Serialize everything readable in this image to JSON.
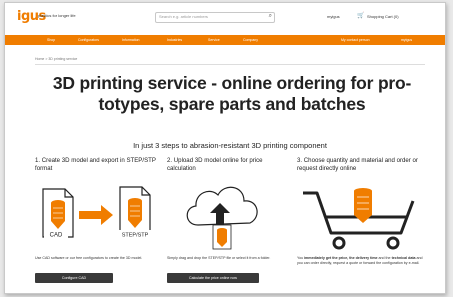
{
  "header": {
    "logo": "igus",
    "tagline": "plastics for longer life",
    "search_placeholder": "Search e.g. article numbers",
    "link_contact": "myigus",
    "cart_label": "Shopping Cart (0)"
  },
  "nav": {
    "items": [
      "Shop",
      "Configurators",
      "Information",
      "Industries",
      "Service",
      "Company"
    ],
    "right": [
      "My contact person",
      "myigus"
    ]
  },
  "breadcrumb": [
    "Home",
    "3D printing service"
  ],
  "page": {
    "title": "3D printing service - online ordering for pro-totypes, spare parts and batches",
    "subtitle": "In just 3 steps to abrasion-resistant 3D printing component"
  },
  "steps": [
    {
      "heading": "1. Create 3D model and export in STEP/STP format",
      "labels": [
        "CAD",
        "STEP/STP"
      ],
      "desc": "Use CAD software or our free configurators to create the 3D model.",
      "button": "Configure CAD"
    },
    {
      "heading": "2. Upload 3D model online for price calculation",
      "desc": "Simply drag and drop the STEP/STP file or select it from a folder.",
      "button": "Calculate the price online now"
    },
    {
      "heading": "3. Choose quantity and material and order or request directly online",
      "desc_pre": "You ",
      "desc_bold1": "immediately get the price, the delivery time",
      "desc_mid": " and the ",
      "desc_bold2": "technical data",
      "desc_post": " and you can order directly, request a quote or forward the configuration by e-mail."
    }
  ],
  "colors": {
    "accent": "#f07d00",
    "button": "#3a3a3a"
  }
}
